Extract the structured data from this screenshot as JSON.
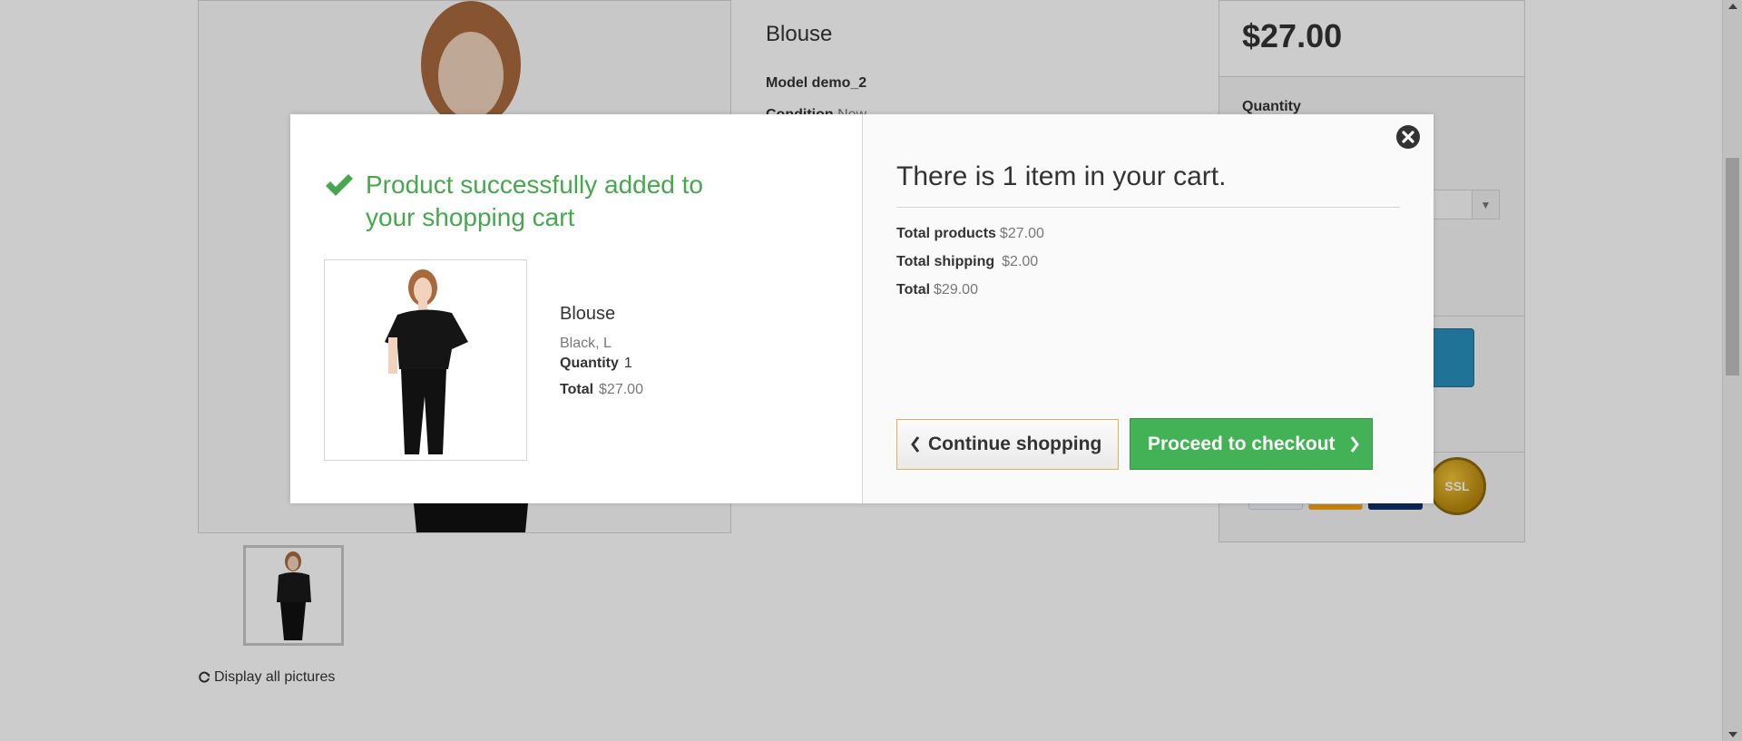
{
  "page": {
    "product_title": "Blouse",
    "model_label": "Model",
    "model_value": "demo_2",
    "condition_label": "Condition",
    "condition_value": "New",
    "price": "$27.00",
    "quantity_label": "Quantity",
    "display_all": "Display all pictures",
    "payment_logos": [
      "paypal-logo",
      "visa-logo",
      "mastercard-logo",
      "ssl-seal"
    ]
  },
  "modal": {
    "success_message": "Product successfully added to your shopping cart",
    "product": {
      "name": "Blouse",
      "attributes": "Black, L",
      "quantity_label": "Quantity",
      "quantity_value": "1",
      "total_label": "Total",
      "total_value": "$27.00"
    },
    "cart": {
      "heading": "There is 1 item in your cart.",
      "total_products_label": "Total products",
      "total_products_value": "$27.00",
      "total_shipping_label": "Total shipping",
      "total_shipping_value": "$2.00",
      "total_label": "Total",
      "total_value": "$29.00"
    },
    "continue_label": "Continue shopping",
    "checkout_label": "Proceed to checkout",
    "close_icon": "close-icon"
  },
  "colors": {
    "success_green": "#46a74e",
    "checkout_green": "#43b155",
    "overlay": "rgba(0,0,0,0.2)",
    "add_to_cart_blue": "#2a8fbd"
  }
}
